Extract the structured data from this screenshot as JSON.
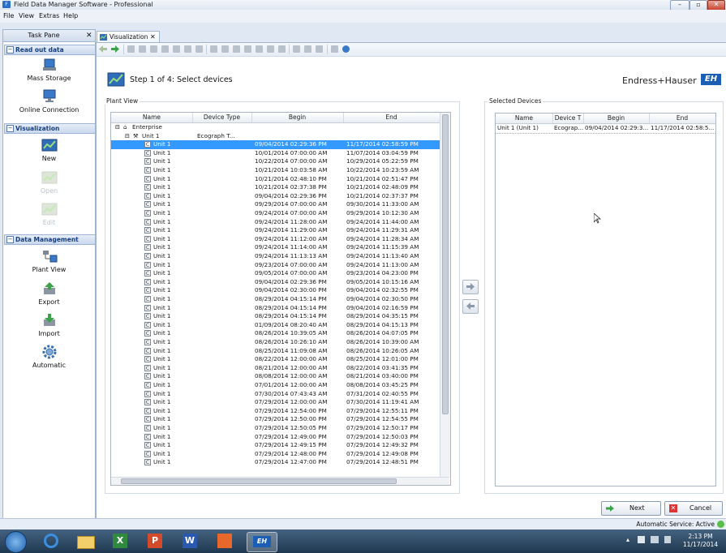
{
  "window": {
    "title": "Field Data Manager Software - Professional"
  },
  "menu": [
    "File",
    "View",
    "Extras",
    "Help"
  ],
  "taskpane": {
    "title": "Task Pane",
    "sections": [
      {
        "label": "Read out data",
        "items": [
          "Mass Storage",
          "Online Connection"
        ]
      },
      {
        "label": "Visualization",
        "items": [
          "New",
          "Open",
          "Edit"
        ]
      },
      {
        "label": "Data Management",
        "items": [
          "Plant View",
          "Export",
          "Import",
          "Automatic"
        ]
      }
    ]
  },
  "tab": {
    "label": "Visualization"
  },
  "step": {
    "title": "Step 1 of 4: Select devices"
  },
  "brand": {
    "name": "Endress+Hauser",
    "logo_text": "EH",
    "accent": "#1a5fb4"
  },
  "plant_view": {
    "label": "Plant View",
    "columns": [
      "Name",
      "Device Type",
      "Begin",
      "End"
    ],
    "tree": [
      {
        "name": "Enterprise",
        "device_type": ""
      },
      {
        "name": "Unit 1",
        "device_type": "Ecograph T..."
      }
    ],
    "rows": [
      {
        "name": "Unit 1",
        "begin": "09/04/2014 02:29:36 PM",
        "end": "11/17/2014 02:58:59 PM"
      },
      {
        "name": "Unit 1",
        "begin": "10/01/2014 07:00:00 AM",
        "end": "11/07/2014 03:04:59 PM"
      },
      {
        "name": "Unit 1",
        "begin": "10/22/2014 07:00:00 AM",
        "end": "10/29/2014 05:22:59 PM"
      },
      {
        "name": "Unit 1",
        "begin": "10/21/2014 10:03:58 AM",
        "end": "10/22/2014 10:23:59 AM"
      },
      {
        "name": "Unit 1",
        "begin": "10/21/2014 02:48:10 PM",
        "end": "10/21/2014 02:51:47 PM"
      },
      {
        "name": "Unit 1",
        "begin": "10/21/2014 02:37:38 PM",
        "end": "10/21/2014 02:48:09 PM"
      },
      {
        "name": "Unit 1",
        "begin": "09/04/2014 02:29:36 PM",
        "end": "10/21/2014 02:37:37 PM"
      },
      {
        "name": "Unit 1",
        "begin": "09/29/2014 07:00:00 AM",
        "end": "09/30/2014 11:33:00 AM"
      },
      {
        "name": "Unit 1",
        "begin": "09/24/2014 07:00:00 AM",
        "end": "09/29/2014 10:12:30 AM"
      },
      {
        "name": "Unit 1",
        "begin": "09/24/2014 11:28:00 AM",
        "end": "09/24/2014 11:44:00 AM"
      },
      {
        "name": "Unit 1",
        "begin": "09/24/2014 11:29:00 AM",
        "end": "09/24/2014 11:29:31 AM"
      },
      {
        "name": "Unit 1",
        "begin": "09/24/2014 11:12:00 AM",
        "end": "09/24/2014 11:28:34 AM"
      },
      {
        "name": "Unit 1",
        "begin": "09/24/2014 11:14:00 AM",
        "end": "09/24/2014 11:15:39 AM"
      },
      {
        "name": "Unit 1",
        "begin": "09/24/2014 11:13:13 AM",
        "end": "09/24/2014 11:13:40 AM"
      },
      {
        "name": "Unit 1",
        "begin": "09/23/2014 07:00:00 AM",
        "end": "09/24/2014 11:13:00 AM"
      },
      {
        "name": "Unit 1",
        "begin": "09/05/2014 07:00:00 AM",
        "end": "09/23/2014 04:23:00 PM"
      },
      {
        "name": "Unit 1",
        "begin": "09/04/2014 02:29:36 PM",
        "end": "09/05/2014 10:15:16 AM"
      },
      {
        "name": "Unit 1",
        "begin": "09/04/2014 02:30:00 PM",
        "end": "09/04/2014 02:32:55 PM"
      },
      {
        "name": "Unit 1",
        "begin": "08/29/2014 04:15:14 PM",
        "end": "09/04/2014 02:30:50 PM"
      },
      {
        "name": "Unit 1",
        "begin": "08/29/2014 04:15:14 PM",
        "end": "09/04/2014 02:16:59 PM"
      },
      {
        "name": "Unit 1",
        "begin": "08/29/2014 04:15:14 PM",
        "end": "08/29/2014 04:35:15 PM"
      },
      {
        "name": "Unit 1",
        "begin": "01/09/2014 08:20:40 AM",
        "end": "08/29/2014 04:15:13 PM"
      },
      {
        "name": "Unit 1",
        "begin": "08/26/2014 10:39:05 AM",
        "end": "08/26/2014 04:07:05 PM"
      },
      {
        "name": "Unit 1",
        "begin": "08/26/2014 10:26:10 AM",
        "end": "08/26/2014 10:39:00 AM"
      },
      {
        "name": "Unit 1",
        "begin": "08/25/2014 11:09:08 AM",
        "end": "08/26/2014 10:26:05 AM"
      },
      {
        "name": "Unit 1",
        "begin": "08/22/2014 12:00:00 AM",
        "end": "08/25/2014 12:01:00 PM"
      },
      {
        "name": "Unit 1",
        "begin": "08/21/2014 12:00:00 AM",
        "end": "08/22/2014 03:41:35 PM"
      },
      {
        "name": "Unit 1",
        "begin": "08/08/2014 12:00:00 AM",
        "end": "08/21/2014 03:40:00 PM"
      },
      {
        "name": "Unit 1",
        "begin": "07/01/2014 12:00:00 AM",
        "end": "08/08/2014 03:45:25 PM"
      },
      {
        "name": "Unit 1",
        "begin": "07/30/2014 07:43:43 AM",
        "end": "07/31/2014 02:40:55 PM"
      },
      {
        "name": "Unit 1",
        "begin": "07/29/2014 12:00:00 AM",
        "end": "07/30/2014 11:19:41 AM"
      },
      {
        "name": "Unit 1",
        "begin": "07/29/2014 12:54:00 PM",
        "end": "07/29/2014 12:55:11 PM"
      },
      {
        "name": "Unit 1",
        "begin": "07/29/2014 12:50:00 PM",
        "end": "07/29/2014 12:54:55 PM"
      },
      {
        "name": "Unit 1",
        "begin": "07/29/2014 12:50:05 PM",
        "end": "07/29/2014 12:50:17 PM"
      },
      {
        "name": "Unit 1",
        "begin": "07/29/2014 12:49:00 PM",
        "end": "07/29/2014 12:50:03 PM"
      },
      {
        "name": "Unit 1",
        "begin": "07/29/2014 12:49:15 PM",
        "end": "07/29/2014 12:49:32 PM"
      },
      {
        "name": "Unit 1",
        "begin": "07/29/2014 12:48:00 PM",
        "end": "07/29/2014 12:49:08 PM"
      },
      {
        "name": "Unit 1",
        "begin": "07/29/2014 12:47:00 PM",
        "end": "07/29/2014 12:48:51 PM"
      }
    ]
  },
  "selected_devices": {
    "label": "Selected Devices",
    "columns": [
      "Name",
      "Device T",
      "Begin",
      "End"
    ],
    "rows": [
      {
        "name": "Unit 1 (Unit 1)",
        "device_type": "Ecograp...",
        "begin": "09/04/2014 02:29:3...",
        "end": "11/17/2014 02:58:5..."
      }
    ]
  },
  "buttons": {
    "next": "Next",
    "cancel": "Cancel"
  },
  "status": {
    "text": "Automatic Service: Active"
  },
  "taskbar": {
    "time": "2:13 PM",
    "date": "11/17/2014"
  }
}
